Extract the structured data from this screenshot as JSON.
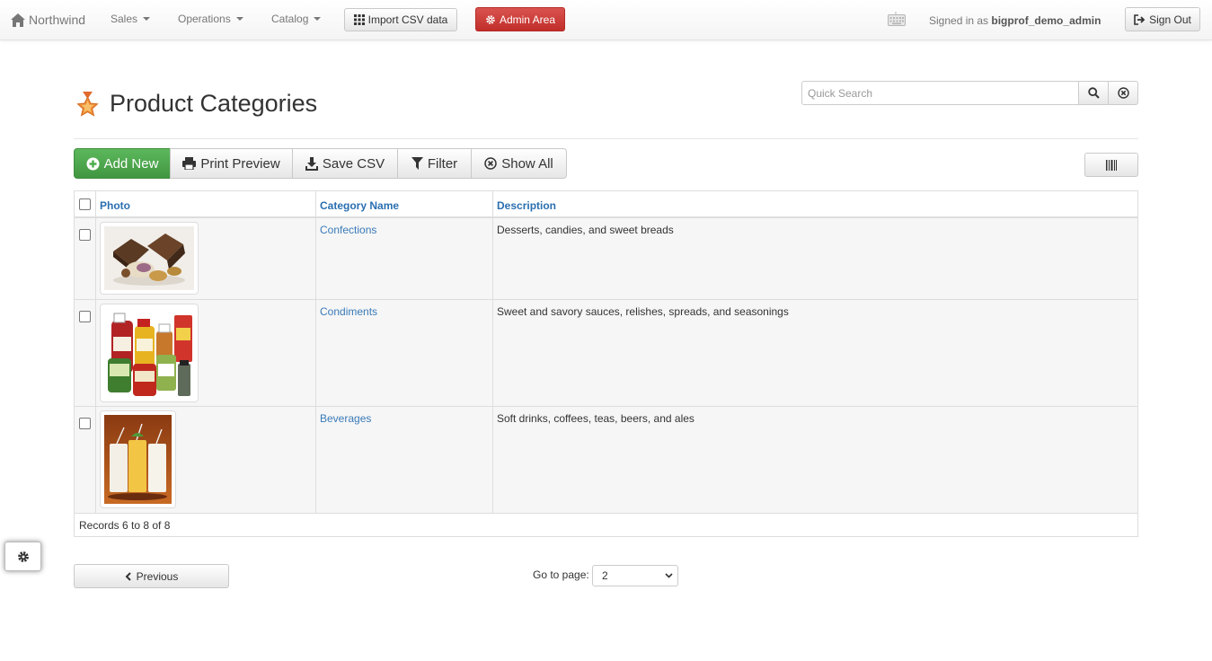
{
  "navbar": {
    "brand": "Northwind",
    "menus": [
      "Sales",
      "Operations",
      "Catalog"
    ],
    "import_label": "Import CSV data",
    "admin_label": "Admin Area",
    "signed_prefix": "Signed in as",
    "username": "bigprof_demo_admin",
    "signout_label": "Sign Out"
  },
  "page": {
    "title": "Product Categories",
    "search_placeholder": "Quick Search"
  },
  "toolbar": {
    "add_new": "Add New",
    "print_preview": "Print Preview",
    "save_csv": "Save CSV",
    "filter": "Filter",
    "show_all": "Show All"
  },
  "table": {
    "headers": [
      "Photo",
      "Category Name",
      "Description"
    ],
    "rows": [
      {
        "photo": "confections-photo",
        "category": "Confections",
        "description": "Desserts, candies, and sweet breads"
      },
      {
        "photo": "condiments-photo",
        "category": "Condiments",
        "description": "Sweet and savory sauces, relishes, spreads, and seasonings"
      },
      {
        "photo": "beverages-photo",
        "category": "Beverages",
        "description": "Soft drinks, coffees, teas, beers, and ales"
      }
    ],
    "records_text": "Records 6 to 8 of 8"
  },
  "pagination": {
    "previous_label": "Previous",
    "goto_label": "Go to page:",
    "current_page": "2"
  },
  "colors": {
    "success": "#5cb85c",
    "danger": "#d9534f",
    "link": "#3a7ab8"
  }
}
